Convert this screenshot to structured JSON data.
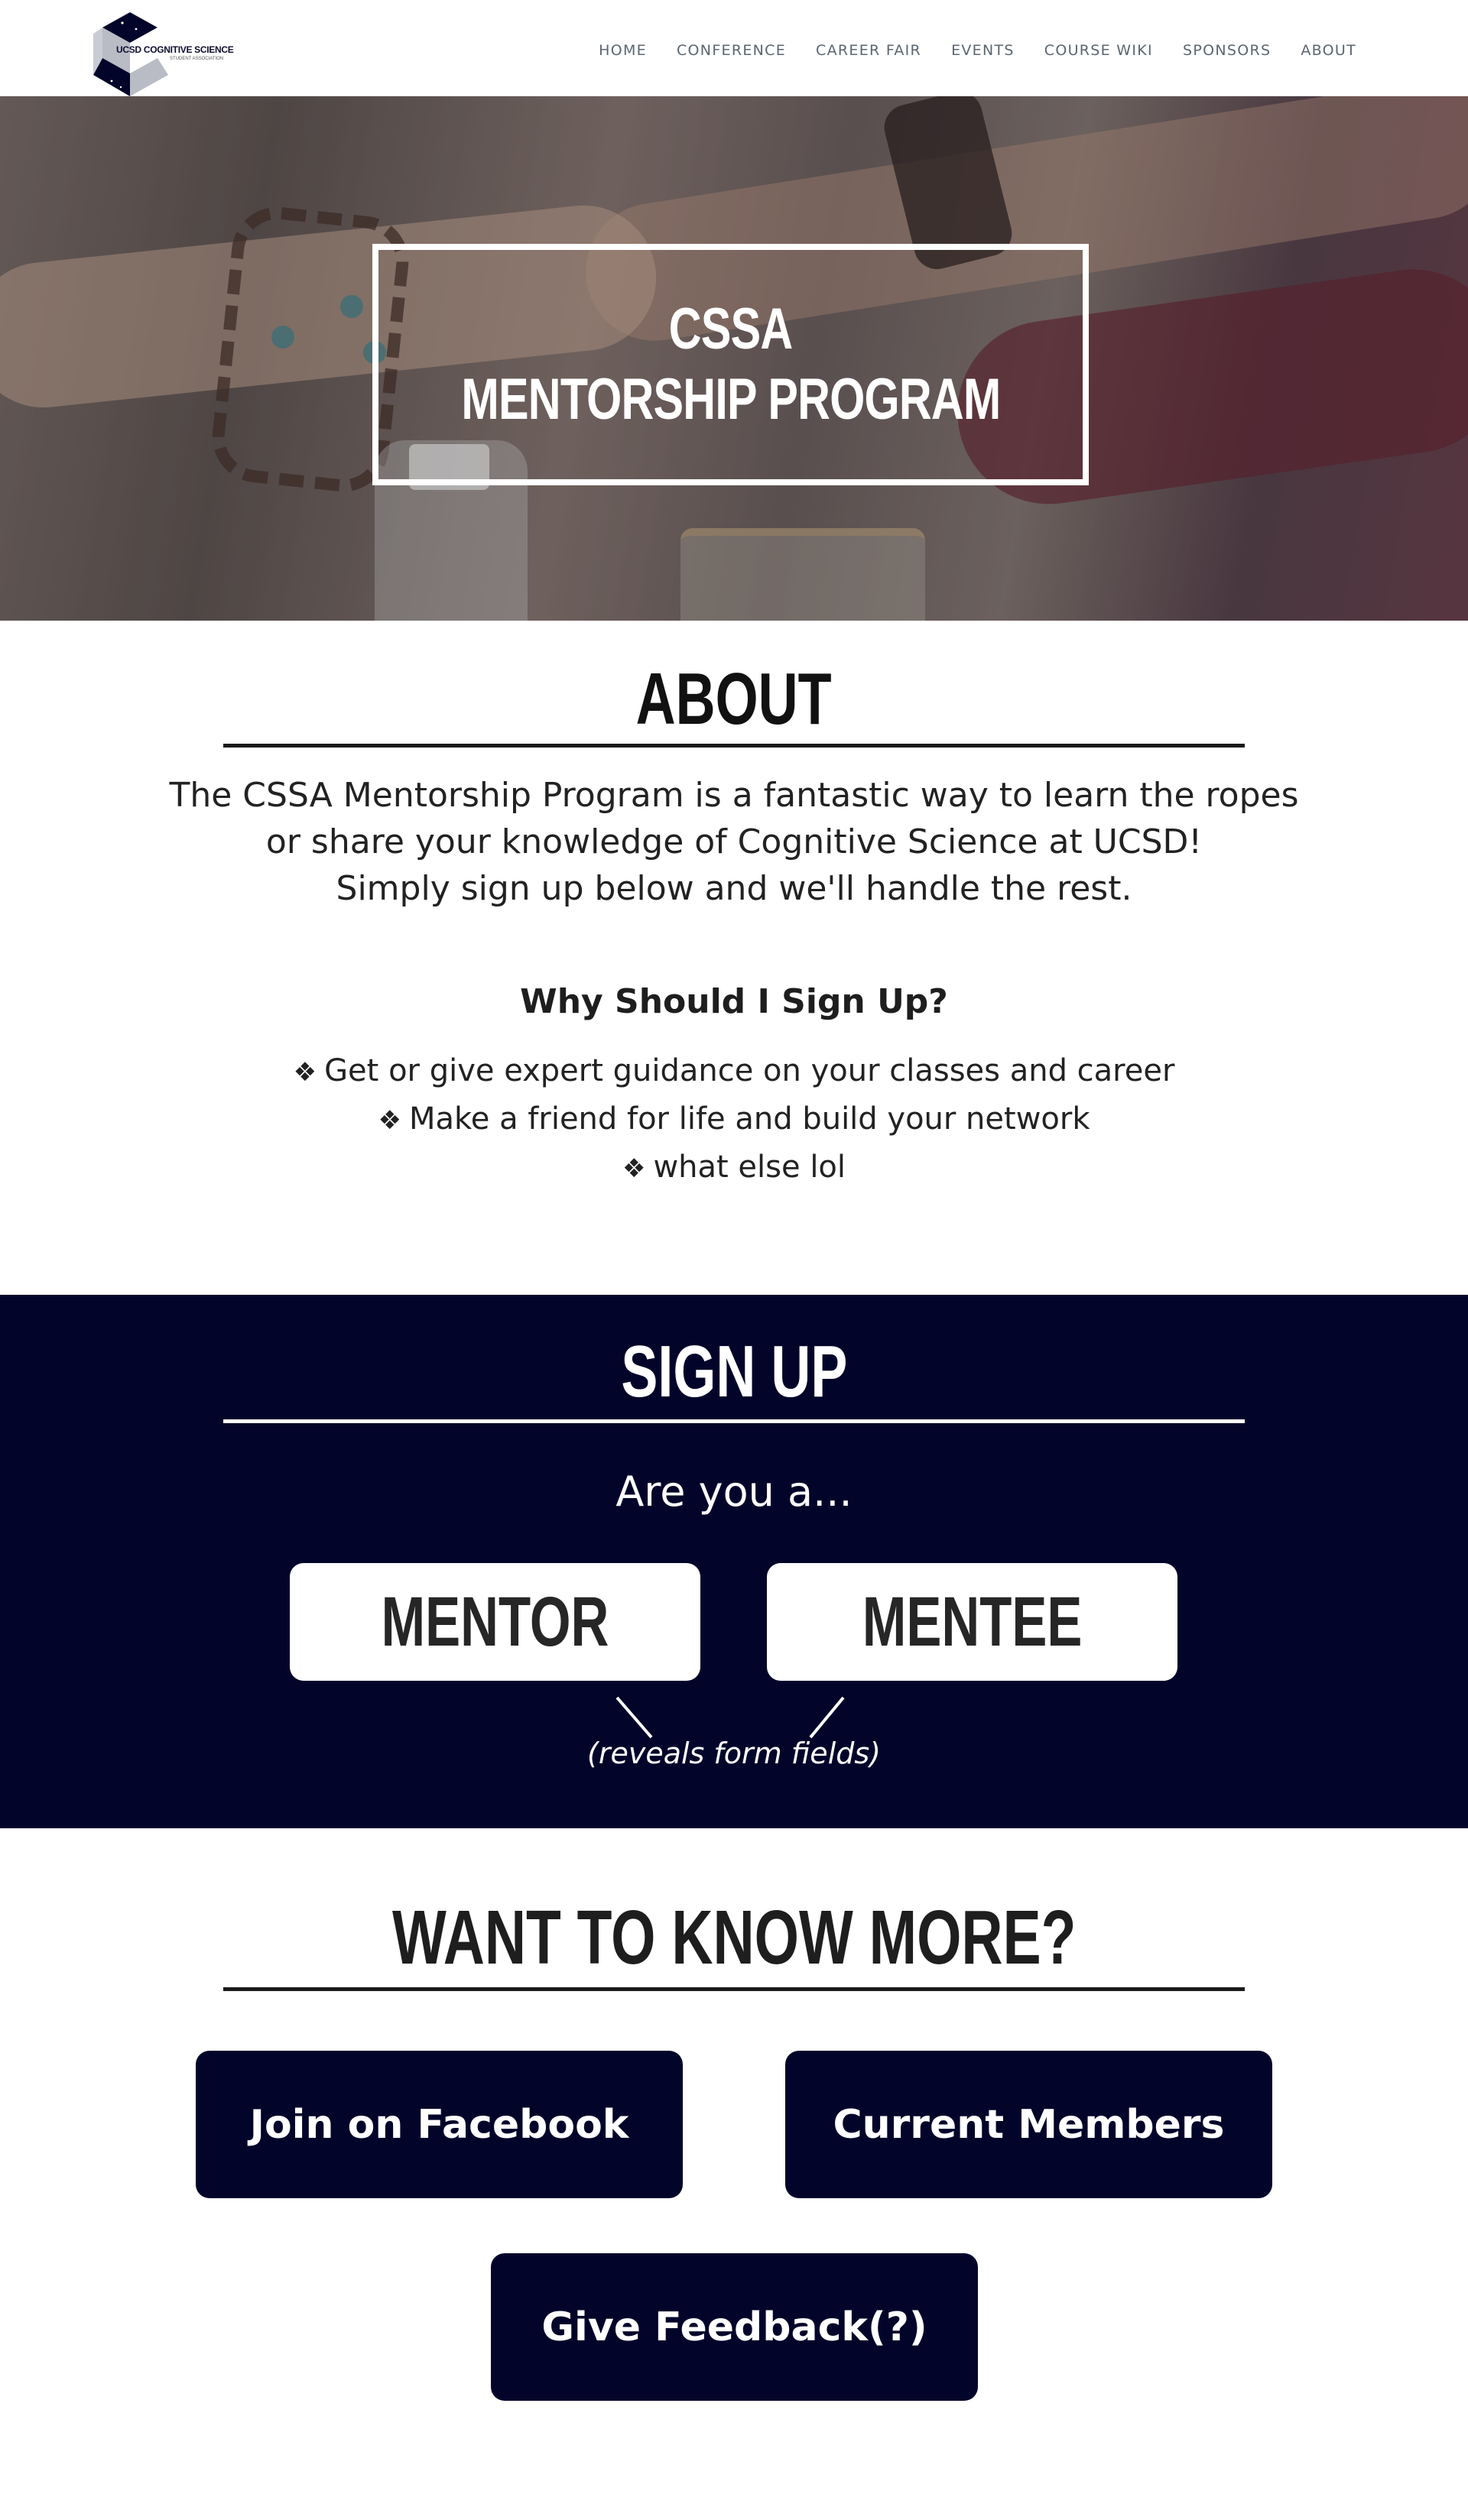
{
  "logo": {
    "title": "UCSD COGNITIVE SCIENCE",
    "subtitle": "STUDENT ASSOCIATION"
  },
  "nav": {
    "items": [
      "HOME",
      "CONFERENCE",
      "CAREER FAIR",
      "EVENTS",
      "COURSE WIKI",
      "SPONSORS",
      "ABOUT"
    ]
  },
  "hero": {
    "title_line1": "CSSA",
    "title_line2": "MENTORSHIP PROGRAM"
  },
  "about": {
    "title": "ABOUT",
    "lines": [
      "The CSSA Mentorship Program is a fantastic way to learn the ropes",
      "or share your knowledge of Cognitive Science at UCSD!",
      "Simply sign up below and we'll handle the rest."
    ],
    "why_title": "Why Should I Sign Up?",
    "bullet_glyph": "❖",
    "why_items": [
      "Get or give expert guidance on your classes and career",
      "Make a friend for life and build your network",
      "what else lol"
    ]
  },
  "signup": {
    "title": "SIGN UP",
    "question": "Are you a...",
    "mentor_label": "MENTOR",
    "mentee_label": "MENTEE",
    "hint": "(reveals form fields)"
  },
  "more": {
    "title": "WANT TO KNOW MORE?",
    "facebook_label": "Join on Facebook",
    "members_label": "Current Members",
    "feedback_label": "Give Feedback(?)"
  },
  "colors": {
    "navy": "#03042a",
    "text": "#1e1e1e",
    "nav_text": "#5c6670",
    "white": "#ffffff"
  }
}
